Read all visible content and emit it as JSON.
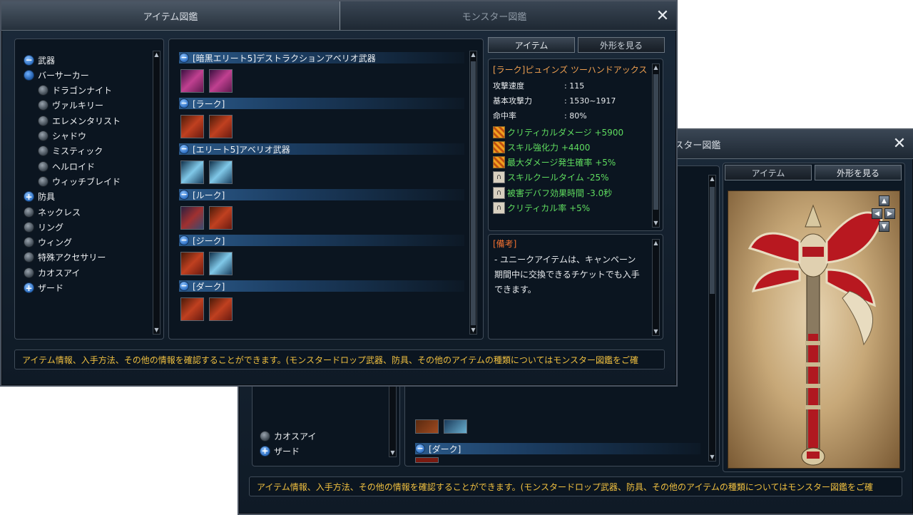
{
  "window1": {
    "tabs": [
      {
        "label": "アイテム図鑑",
        "active": true
      },
      {
        "label": "モンスター図鑑",
        "active": false
      }
    ],
    "tree": [
      {
        "label": "武器",
        "type": "minus"
      },
      {
        "label": "バーサーカー",
        "type": "radio-selected"
      },
      {
        "label": "ドラゴンナイト",
        "type": "radio"
      },
      {
        "label": "ヴァルキリー",
        "type": "radio"
      },
      {
        "label": "エレメンタリスト",
        "type": "radio"
      },
      {
        "label": "シャドウ",
        "type": "radio"
      },
      {
        "label": "ミスティック",
        "type": "radio"
      },
      {
        "label": "ヘルロイド",
        "type": "radio"
      },
      {
        "label": "ウィッチブレイド",
        "type": "radio"
      },
      {
        "label": "防具",
        "type": "plus"
      },
      {
        "label": "ネックレス",
        "type": "radio"
      },
      {
        "label": "リング",
        "type": "radio"
      },
      {
        "label": "ウィング",
        "type": "radio"
      },
      {
        "label": "特殊アクセサリー",
        "type": "radio"
      },
      {
        "label": "カオスアイ",
        "type": "radio"
      },
      {
        "label": "ザード",
        "type": "plus"
      }
    ],
    "categories": [
      {
        "label": "[暗黒エリート5]デストラクションアベリオ武器",
        "icons": [
          "purple",
          "purple"
        ]
      },
      {
        "label": "[ラーク]",
        "icons": [
          "red",
          "red"
        ]
      },
      {
        "label": "[エリート5]アベリオ武器",
        "icons": [
          "blue",
          "blue"
        ]
      },
      {
        "label": "[ルーク]",
        "icons": [
          "mixed",
          "red"
        ]
      },
      {
        "label": "[ジーク]",
        "icons": [
          "red",
          "blue"
        ]
      },
      {
        "label": "[ダーク]",
        "icons": [
          "red",
          "red"
        ]
      }
    ],
    "detail_tabs": [
      {
        "label": "アイテム",
        "active": true
      },
      {
        "label": "外形を見る",
        "active": false
      }
    ],
    "item": {
      "name": "[ラーク]ピュインズ ツーハンドアックス",
      "stats": [
        {
          "label": "攻撃速度",
          "value": ": 115"
        },
        {
          "label": "基本攻撃力",
          "value": ": 1530~1917"
        },
        {
          "label": "命中率",
          "value": ": 80%"
        }
      ],
      "effects": [
        {
          "text": "クリティカルダメージ +5900",
          "icon": "orange"
        },
        {
          "text": "スキル強化力 +4400",
          "icon": "orange"
        },
        {
          "text": "最大ダメージ発生確率 +5%",
          "icon": "orange"
        },
        {
          "text": "スキルクールタイム -25%",
          "icon": "lock"
        },
        {
          "text": "被害デバフ効果時間 -3.0秒",
          "icon": "lock"
        },
        {
          "text": "クリティカル率 +5%",
          "icon": "lock"
        }
      ]
    },
    "note": {
      "title": "[備考]",
      "lines": [
        "- ユニークアイテムは、キャンペーン",
        "期間中に交換できるチケットでも入手",
        "できます。"
      ]
    },
    "status": "アイテム情報、入手方法、その他の情報を確認することができます。(モンスタードロップ武器、防具、その他のアイテムの種類についてはモンスター図鑑をご確"
  },
  "window2": {
    "title": "モンスター図鑑",
    "tree_visible": [
      {
        "label": "カオスアイ",
        "type": "radio"
      },
      {
        "label": "ザード",
        "type": "plus"
      }
    ],
    "category_visible": {
      "label": "[ダーク]"
    },
    "detail_tabs": [
      {
        "label": "アイテム",
        "active": false
      },
      {
        "label": "外形を見る",
        "active": true
      }
    ],
    "status": "アイテム情報、入手方法、その他の情報を確認することができます。(モンスタードロップ武器、防具、その他のアイテムの種類についてはモンスター図鑑をご確"
  },
  "icons": {
    "close": "close-icon",
    "minus": "minus-icon",
    "plus": "plus-icon",
    "radio": "radio-icon",
    "arrow_up": "▲",
    "arrow_down": "▼",
    "arrow_left": "◀",
    "arrow_right": "▶"
  },
  "colors": {
    "item_name": "#f0a050",
    "effect_text": "#5fdc5f",
    "status_text": "#f0c040",
    "note_title": "#f07030"
  }
}
